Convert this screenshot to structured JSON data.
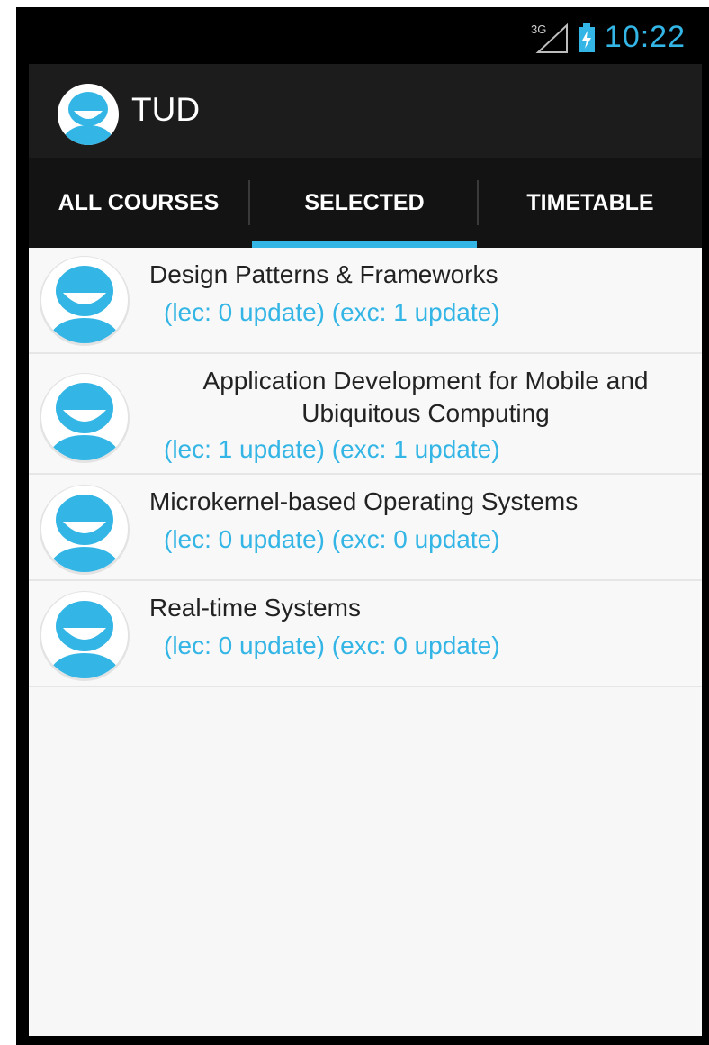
{
  "status_bar": {
    "network": "3G",
    "time": "10:22"
  },
  "action_bar": {
    "title": "TUD",
    "icon": "avatar-logo-icon"
  },
  "tabs": [
    {
      "label": "ALL COURSES",
      "selected": false
    },
    {
      "label": "SELECTED",
      "selected": true
    },
    {
      "label": "TIMETABLE",
      "selected": false
    }
  ],
  "courses": [
    {
      "title_lines": [
        "Design Patterns & Frameworks"
      ],
      "updates": "(lec: 0 update) (exc: 1 update)"
    },
    {
      "title_lines": [
        "Application Development for Mobile and",
        "Ubiquitous Computing"
      ],
      "updates": "(lec: 1 update) (exc: 1 update)"
    },
    {
      "title_lines": [
        "Microkernel-based Operating Systems"
      ],
      "updates": "(lec: 0 update) (exc: 0 update)"
    },
    {
      "title_lines": [
        "Real-time Systems"
      ],
      "updates": "(lec: 0 update) (exc: 0 update)"
    }
  ],
  "colors": {
    "accent": "#33b5e5",
    "action_bar": "#1c1c1c",
    "tab_bar": "#131313"
  }
}
